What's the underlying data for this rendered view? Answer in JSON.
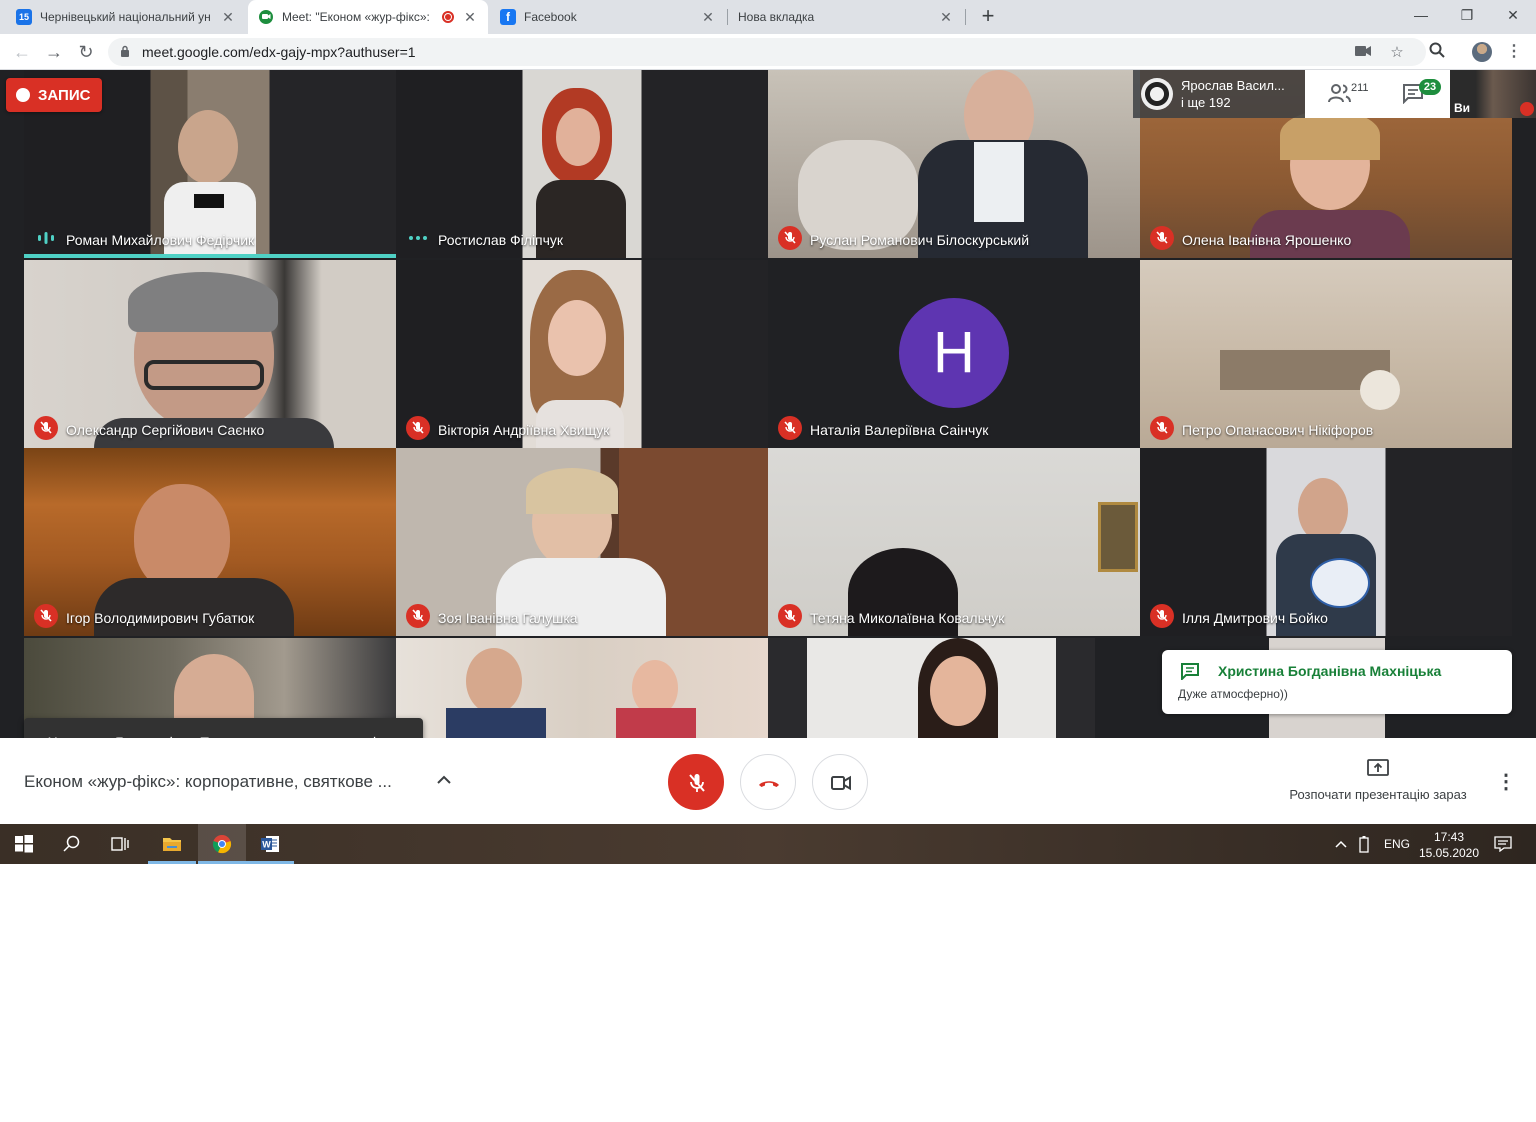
{
  "browser": {
    "tabs": [
      {
        "title": "Чернівецький національний ун",
        "favicon": "calendar-icon",
        "favicon_text": "15"
      },
      {
        "title": "Meet: \"Економ «жур-фікс»:",
        "favicon": "meet-icon"
      },
      {
        "title": "Facebook",
        "favicon": "facebook-icon"
      },
      {
        "title": "Нова вкладка",
        "favicon": ""
      }
    ],
    "url": "meet.google.com/edx-gajy-mpx?authuser=1"
  },
  "recording_label": "ЗАПИС",
  "presenter": {
    "name": "Ярослав Васил...",
    "others": "і ще 192"
  },
  "people_count": "211",
  "chat_unread": "23",
  "self_label": "Ви",
  "participants": [
    {
      "name": "Роман Михайлович Федірчик",
      "state": "speaking"
    },
    {
      "name": "Ростислав Філіпчук",
      "state": "active"
    },
    {
      "name": "Руслан Романович Білоскурський",
      "state": "muted"
    },
    {
      "name": "Олена Іванівна Ярошенко",
      "state": "muted"
    },
    {
      "name": "Олександр Сергійович Саєнко",
      "state": "muted"
    },
    {
      "name": "Вікторія Андріївна Хвищук",
      "state": "muted"
    },
    {
      "name": "Наталія Валеріївна Саінчук",
      "state": "muted",
      "avatar_letter": "Н"
    },
    {
      "name": "Петро Опанасович Нікіфоров",
      "state": "muted"
    },
    {
      "name": "Ігор Володимирович Губатюк",
      "state": "muted"
    },
    {
      "name": "Зоя Іванівна Галушка",
      "state": "muted"
    },
    {
      "name": "Тетяна Миколаївна Ковальчук",
      "state": "muted"
    },
    {
      "name": "Ілля Дмитрович Бойко",
      "state": "muted"
    }
  ],
  "chat_notification": {
    "sender": "Христина Богданівна Махніцька",
    "message": "Дуже атмосферно))"
  },
  "leave_notification": "Христина Ярославівна Проскурняк залишає зустріч",
  "meeting_title": "Економ «жур-фікс»: корпоративне, святкове ...",
  "present_label": "Розпочати презентацію зараз",
  "taskbar": {
    "language": "ENG",
    "time": "17:43",
    "date": "15.05.2020"
  },
  "colors": {
    "accent_red": "#d93025",
    "meet_green": "#188038",
    "speaker_teal": "#4fd1c5",
    "avatar_purple": "#5e35b1"
  }
}
